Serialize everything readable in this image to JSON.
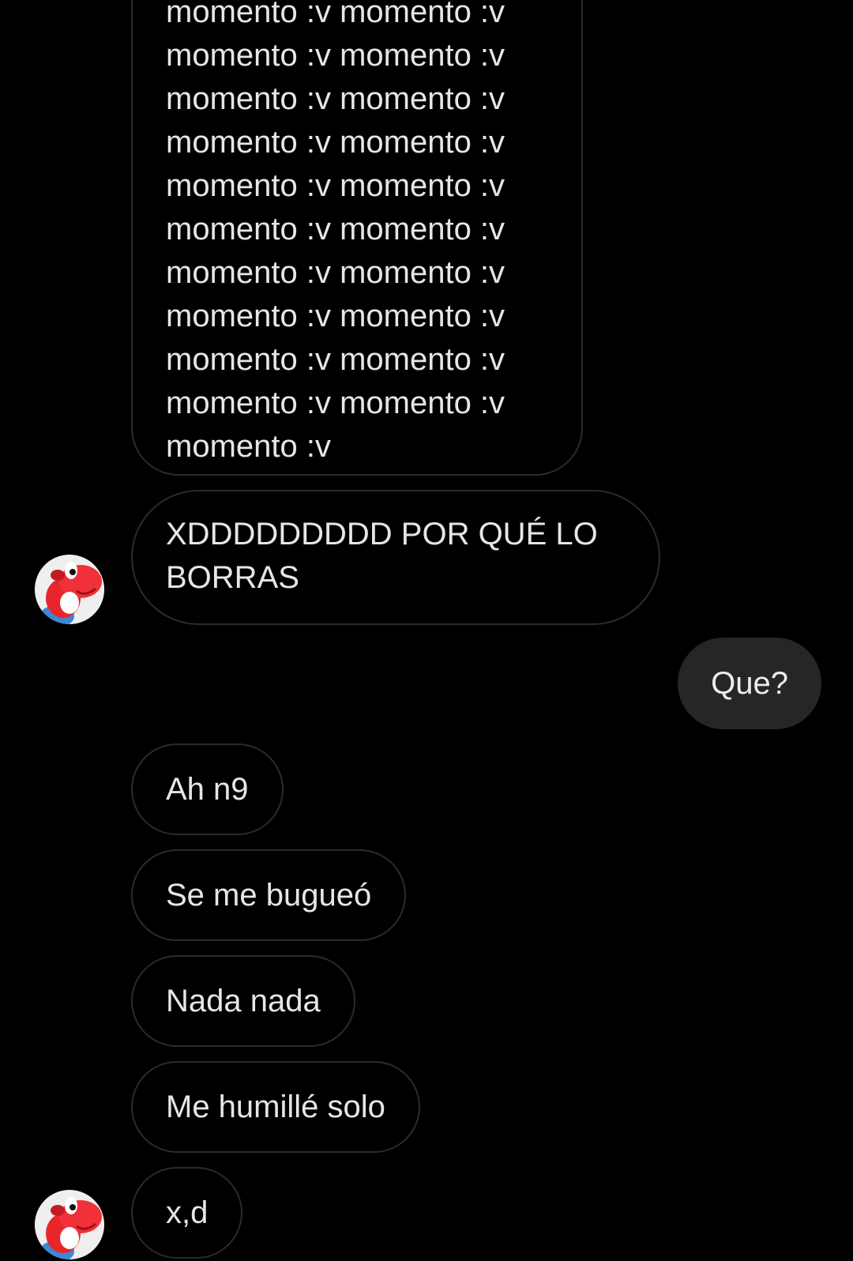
{
  "conversation": {
    "messages": [
      {
        "direction": "incoming",
        "text": "momento :v momento :v\nmomento :v momento :v\nmomento :v momento :v\nmomento :v momento :v\nmomento :v momento :v\nmomento :v momento :v\nmomento :v momento :v\nmomento :v momento :v\nmomento :v momento :v\nmomento :v momento :v\nmomento :v"
      },
      {
        "direction": "incoming",
        "text": "XDDDDDDDDD POR QUÉ LO\nBORRAS"
      },
      {
        "direction": "outgoing",
        "text": "Que?"
      },
      {
        "direction": "incoming",
        "text": "Ah n9"
      },
      {
        "direction": "incoming",
        "text": "Se me bugueó"
      },
      {
        "direction": "incoming",
        "text": "Nada nada"
      },
      {
        "direction": "incoming",
        "text": "Me humillé solo"
      },
      {
        "direction": "incoming",
        "text": "x,d"
      }
    ],
    "avatar": {
      "icon": "red-yoshi-avatar-icon"
    }
  },
  "colors": {
    "background": "#000000",
    "incoming_border": "#2b2b2b",
    "outgoing_bubble": "#262626",
    "text": "#e6e6e6"
  }
}
